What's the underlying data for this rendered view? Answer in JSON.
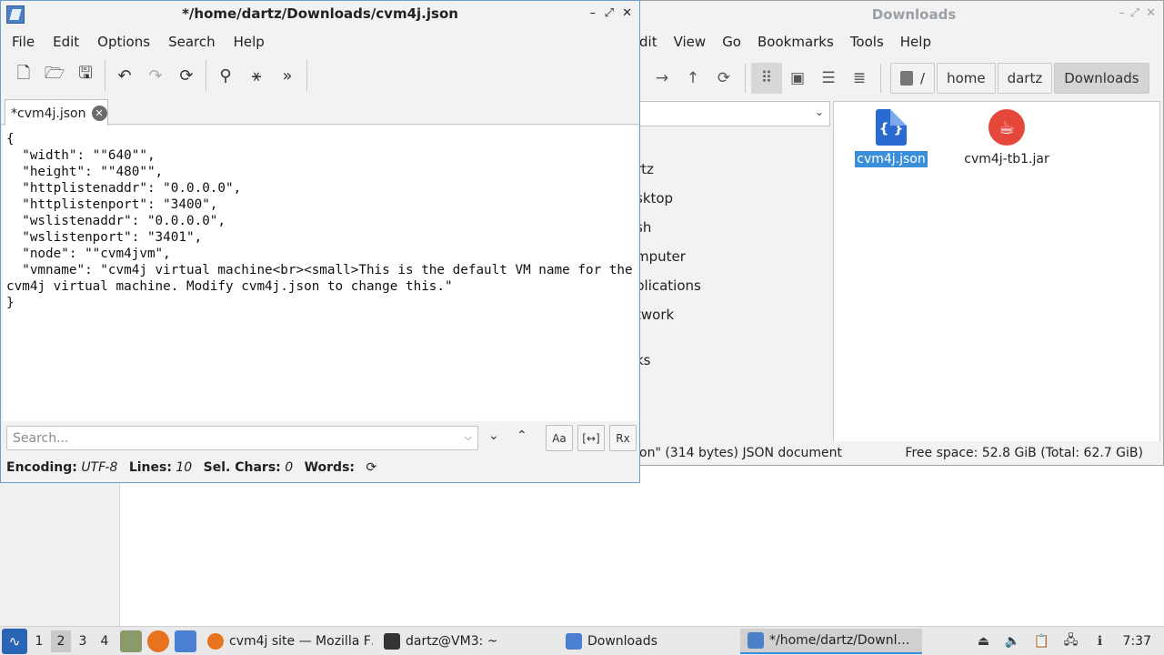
{
  "file_manager": {
    "title": "Downloads",
    "menu": [
      "Edit",
      "View",
      "Go",
      "Bookmarks",
      "Tools",
      "Help"
    ],
    "menu_first_visible": "dit",
    "breadcrumb": [
      "/",
      "home",
      "dartz",
      "Downloads"
    ],
    "sidebar": [
      "rtz",
      "sktop",
      "sh",
      "mputer",
      "plications",
      "twork",
      "ks"
    ],
    "files": [
      {
        "name": "cvm4j.json",
        "icon": "json-file-icon",
        "selected": true
      },
      {
        "name": "cvm4j-tb1.jar",
        "icon": "java-jar-icon",
        "selected": false
      }
    ],
    "status_left": "on\" (314 bytes) JSON document",
    "status_right": "Free space: 52.8 GiB (Total: 62.7 GiB)"
  },
  "editor": {
    "title": "*/home/dartz/Downloads/cvm4j.json",
    "menu": [
      "File",
      "Edit",
      "Options",
      "Search",
      "Help"
    ],
    "tab_label": "*cvm4j.json",
    "content": "{\n  \"width\": \"\"640\"\",\n  \"height\": \"\"480\"\",\n  \"httplistenaddr\": \"0.0.0.0\",\n  \"httplistenport\": \"3400\",\n  \"wslistenaddr\": \"0.0.0.0\",\n  \"wslistenport\": \"3401\",\n  \"node\": \"\"cvm4jvm\",\n  \"vmname\": \"cvm4j virtual machine<br><small>This is the default VM name for the cvm4j virtual machine. Modify cvm4j.json to change this.\"\n}",
    "search_placeholder": "Search...",
    "status": {
      "encoding_label": "Encoding:",
      "encoding_value": "UTF-8",
      "lines_label": "Lines:",
      "lines_value": "10",
      "sel_label": "Sel. Chars:",
      "sel_value": "0",
      "words_label": "Words:"
    }
  },
  "taskbar": {
    "workspaces": [
      "1",
      "2",
      "3",
      "4"
    ],
    "active_workspace": "2",
    "tasks": [
      {
        "label": "cvm4j site — Mozilla F…",
        "icon": "firefox-icon"
      },
      {
        "label": "dartz@VM3: ~",
        "icon": "terminal-icon"
      },
      {
        "label": "Downloads",
        "icon": "folder-icon"
      },
      {
        "label": "*/home/dartz/Downl…",
        "icon": "text-editor-icon"
      }
    ],
    "clock": "7:37"
  },
  "colors": {
    "selection": "#3b8fd9",
    "json_icon": "#2a6bd1",
    "jar_icon": "#e5483a",
    "active_window_border": "#6b9fd1"
  }
}
